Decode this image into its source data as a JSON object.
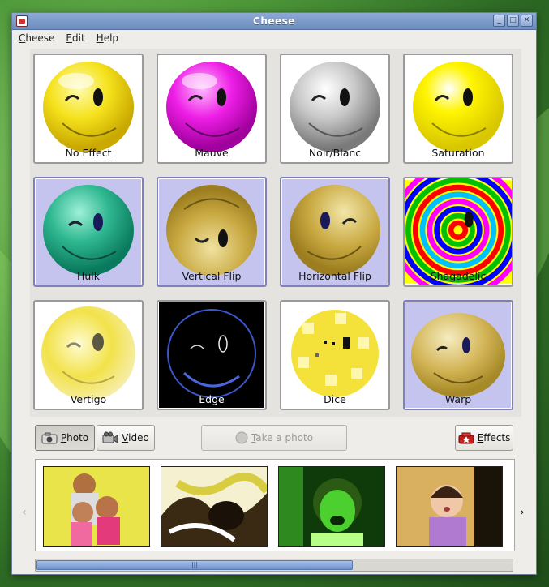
{
  "window": {
    "title": "Cheese"
  },
  "menu": [
    {
      "label": "Cheese",
      "mnemonic": "C",
      "rest": "heese"
    },
    {
      "label": "Edit",
      "mnemonic": "E",
      "rest": "dit"
    },
    {
      "label": "Help",
      "mnemonic": "H",
      "rest": "elp"
    }
  ],
  "effects": [
    {
      "label": "No Effect",
      "selected": false
    },
    {
      "label": "Mauve",
      "selected": false
    },
    {
      "label": "Noir/Blanc",
      "selected": false
    },
    {
      "label": "Saturation",
      "selected": false
    },
    {
      "label": "Hulk",
      "selected": true
    },
    {
      "label": "Vertical Flip",
      "selected": true
    },
    {
      "label": "Horizontal Flip",
      "selected": true
    },
    {
      "label": "Shagadelic",
      "selected": false
    },
    {
      "label": "Vertigo",
      "selected": false
    },
    {
      "label": "Edge",
      "selected": false
    },
    {
      "label": "Dice",
      "selected": false
    },
    {
      "label": "Warp",
      "selected": true
    }
  ],
  "controls": {
    "photo_mnemonic": "P",
    "photo_rest": "hoto",
    "video_mnemonic": "V",
    "video_rest": "ideo",
    "take_mnemonic": "T",
    "take_rest": "ake a photo",
    "effects_mnemonic": "E",
    "effects_rest": "ffects"
  },
  "filmstrip": {
    "shots": [
      "photo-1",
      "photo-2",
      "photo-3",
      "photo-4"
    ],
    "scroll_handle_text": "|||"
  },
  "colors": {
    "selection": "#c4c4ee",
    "titlebar": "#7d9ac8"
  }
}
